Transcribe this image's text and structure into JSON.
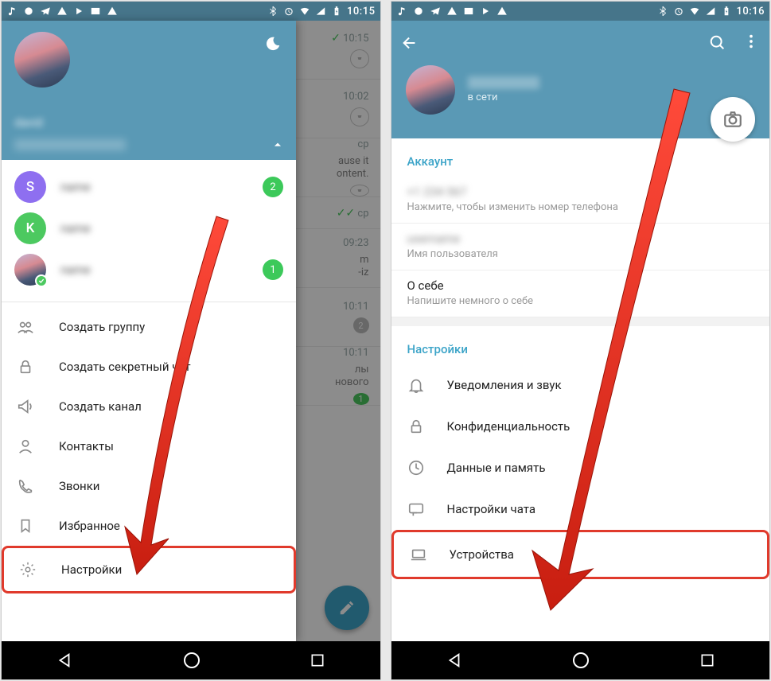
{
  "statusbar": {
    "time_left": "10:15",
    "time_right": "10:16"
  },
  "drawer": {
    "name": "david",
    "accounts": [
      {
        "letter": "S",
        "color": "#8e6ff0",
        "badge": "2"
      },
      {
        "letter": "K",
        "color": "#4cc960",
        "badge": ""
      },
      {
        "letter": "",
        "color": "",
        "badge": "1",
        "avatar": true
      }
    ],
    "menu": {
      "create_group": "Создать группу",
      "secret_chat": "Создать секретный чат",
      "create_channel": "Создать канал",
      "contacts": "Контакты",
      "calls": "Звонки",
      "favorites": "Избранное",
      "settings": "Настройки"
    }
  },
  "bg": {
    "rows": [
      {
        "time": "10:15",
        "tick": true,
        "pin": true
      },
      {
        "time": "10:02",
        "pin": true
      },
      {
        "time": "ср",
        "text": "ause it\nontent.",
        "pin": true
      },
      {
        "time": "ср",
        "dtick": true
      },
      {
        "time": "09:23",
        "text": "m\n-iz"
      },
      {
        "time": "10:11",
        "badgeGrey": "2"
      },
      {
        "time": "10:11",
        "text": "лы\nнового",
        "badgeGreen": "1"
      }
    ]
  },
  "profile": {
    "status": "в сети",
    "section_account": "Аккаунт",
    "phone_hint": "Нажмите, чтобы изменить номер телефона",
    "username_hint": "Имя пользователя",
    "about_label": "О себе",
    "about_hint": "Напишите немного о себе",
    "section_settings": "Настройки",
    "rows": {
      "notifications": "Уведомления и звук",
      "privacy": "Конфиденциальность",
      "data": "Данные и память",
      "chat": "Настройки чата",
      "devices": "Устройства"
    }
  }
}
